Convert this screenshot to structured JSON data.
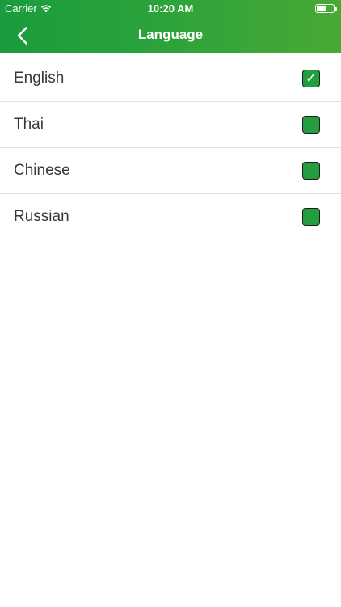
{
  "status_bar": {
    "carrier": "Carrier",
    "time": "10:20 AM"
  },
  "nav": {
    "title": "Language"
  },
  "languages": [
    {
      "label": "English",
      "checked": true
    },
    {
      "label": "Thai",
      "checked": false
    },
    {
      "label": "Chinese",
      "checked": false
    },
    {
      "label": "Russian",
      "checked": false
    }
  ],
  "icons": {
    "wifi": "wifi-icon",
    "battery": "battery-icon",
    "back": "chevron-left-icon",
    "check": "checkmark-icon"
  },
  "colors": {
    "header_gradient_start": "#199c3d",
    "header_gradient_end": "#49a934",
    "checkbox_fill": "#229d3f",
    "text": "#333a3d",
    "divider": "#e1e1e1"
  }
}
